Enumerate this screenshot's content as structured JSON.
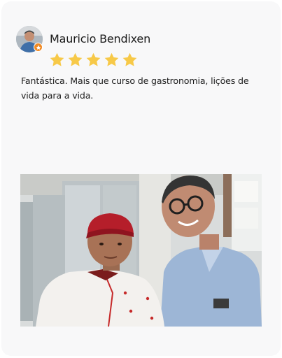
{
  "review": {
    "reviewer_name": "Mauricio Bendixen",
    "rating": 5,
    "rating_max": 5,
    "text": "Fantástica. Mais que curso de gastronomia, lições de vida para a vida.",
    "star_color": "#f7c948",
    "badge_color": "#f08a24",
    "photo_alt": "Foto do aluno com Mauricio Bendixen"
  }
}
